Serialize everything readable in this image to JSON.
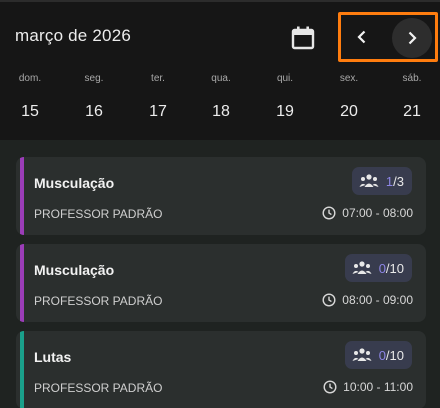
{
  "header": {
    "month_label": "março de 2026"
  },
  "week": {
    "days": [
      {
        "weekday": "dom.",
        "day": "15"
      },
      {
        "weekday": "seg.",
        "day": "16"
      },
      {
        "weekday": "ter.",
        "day": "17"
      },
      {
        "weekday": "qua.",
        "day": "18"
      },
      {
        "weekday": "qui.",
        "day": "19"
      },
      {
        "weekday": "sex.",
        "day": "20"
      },
      {
        "weekday": "sáb.",
        "day": "21"
      }
    ]
  },
  "classes": [
    {
      "title": "Musculação",
      "teacher": "PROFESSOR PADRÃO",
      "occupied": "1",
      "capacity": "/3",
      "time": "07:00 - 08:00",
      "accent": "#9b3db8"
    },
    {
      "title": "Musculação",
      "teacher": "PROFESSOR PADRÃO",
      "occupied": "0",
      "capacity": "/10",
      "time": "08:00 - 09:00",
      "accent": "#9b3db8"
    },
    {
      "title": "Lutas",
      "teacher": "PROFESSOR PADRÃO",
      "occupied": "0",
      "capacity": "/10",
      "time": "10:00 - 11:00",
      "accent": "#1aa08b"
    }
  ],
  "colors": {
    "nav_highlight": "#ff7d0f",
    "count_accent": "#8d86e6"
  },
  "icons": {
    "calendar": "calendar-icon",
    "prev": "chevron-left-icon",
    "next": "chevron-right-icon",
    "people": "group-icon",
    "clock": "clock-icon"
  }
}
